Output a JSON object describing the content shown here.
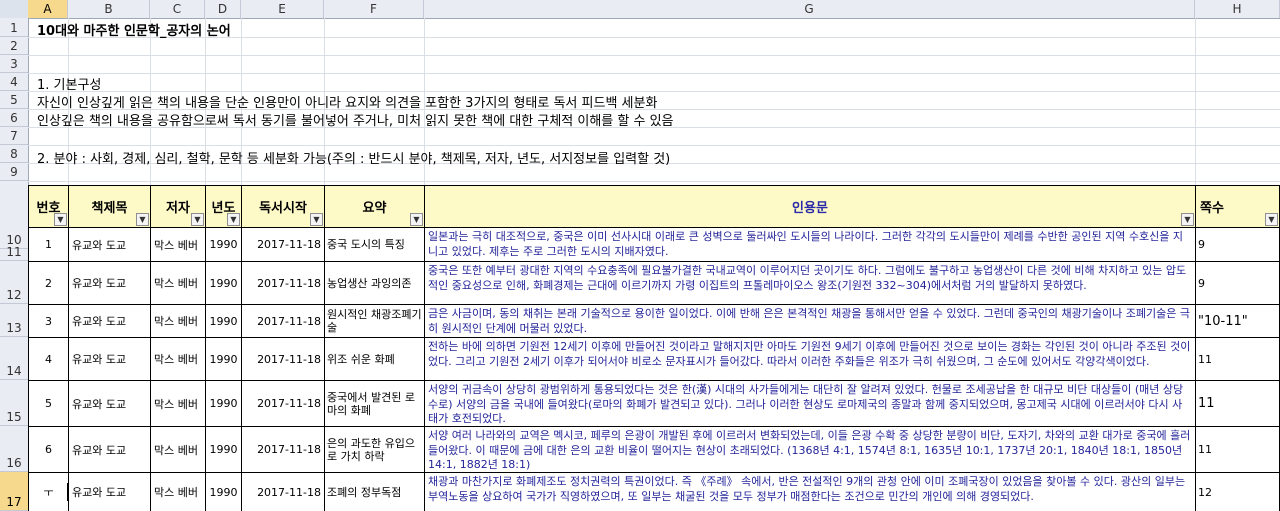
{
  "columns": [
    "A",
    "B",
    "C",
    "D",
    "E",
    "F",
    "G",
    "H"
  ],
  "rows": [
    "1",
    "2",
    "3",
    "4",
    "5",
    "6",
    "7",
    "8",
    "9",
    "10",
    "11",
    "12",
    "13",
    "14",
    "15",
    "16",
    "17"
  ],
  "title": "10대와 마주한 인문학_공자의 논어",
  "intro": {
    "line4": "1. 기본구성",
    "line5": "자신이 인상깊게 읽은 책의 내용을 단순 인용만이 아니라 요지와 의견을 포함한 3가지의 형태로 독서 피드백 세분화",
    "line6": "인상깊은 책의 내용을 공유함으로써 독서 동기를 불어넣어 주거나, 미처 읽지 못한 책에 대한 구체적 이해를 할 수 있음",
    "line8": "2. 분야 : 사회, 경제, 심리, 철학, 문학 등 세분화 가능(주의 : 반드시 분야, 책제목, 저자, 년도, 서지정보를 입력할 것)"
  },
  "table": {
    "headers": [
      "번호",
      "책제목",
      "저자",
      "년도",
      "독서시작",
      "요약",
      "인용문",
      "쪽수"
    ],
    "filter_icon": "dropdown-arrow",
    "rows": [
      {
        "no": "1",
        "book": "유교와 도교",
        "author": "막스 베버",
        "year": "1990",
        "date": "2017-11-18",
        "summary": "중국 도시의 특징",
        "quote": "일본과는 극히 대조적으로, 중국은 이미 선사시대 이래로 큰 성벽으로 둘러싸인 도시들의 나라이다. 그러한 각각의 도시들만이 제례를 수반한 공인된 지역 수호신을 지니고 있었다. 제후는 주로 그러한 도시의 지배자였다.",
        "page": "9"
      },
      {
        "no": "2",
        "book": "유교와 도교",
        "author": "막스 베버",
        "year": "1990",
        "date": "2017-11-18",
        "summary": "농업생산 과잉의존",
        "quote": "중국은 또한 예부터 광대한 지역의 수요충족에 필요불가결한 국내교역이 이루어지던 곳이기도 하다. 그럼에도 불구하고 농업생산이 다른 것에 비해 차지하고 있는 압도적인 중요성으로 인해, 화폐경제는 근대에 이르기까지 가령 이집트의 프톨레마이오스 왕조(기원전 332~304)에서처럼 거의 발달하지 못하였다.",
        "page": "9"
      },
      {
        "no": "3",
        "book": "유교와 도교",
        "author": "막스 베버",
        "year": "1990",
        "date": "2017-11-18",
        "summary": "원시적인 채광조폐기술",
        "quote": "금은 사금이며, 동의 채취는 본래 기술적으로 용이한 일이었다. 이에 반해 은은 본격적인 채광을 통해서만 얻을 수 있었다. 그런데 중국인의 채광기술이나 조폐기술은 극히 원시적인 단계에 머물러 있었다.",
        "page": "\"10-11\""
      },
      {
        "no": "4",
        "book": "유교와 도교",
        "author": "막스 베버",
        "year": "1990",
        "date": "2017-11-18",
        "summary": "위조 쉬운 화폐",
        "quote": "전하는 바에 의하면 기원전 12세기 이후에 만들어진 것이라고 말해지지만 아마도 기원전 9세기 이후에 만들어진 것으로 보이는 경화는 각인된 것이 아니라 주조된 것이었다. 그리고 기원전 2세기 이후가 되어서야 비로소 문자표시가 들어갔다. 따라서 이러한 주화들은 위조가 극히 쉬웠으며, 그 순도에 있어서도 각양각색이었다.",
        "page": "11"
      },
      {
        "no": "5",
        "book": "유교와 도교",
        "author": "막스 베버",
        "year": "1990",
        "date": "2017-11-18",
        "summary": "중국에서 발견된 로마의 화폐",
        "quote": "서양의 귀금속이 상당히 광범위하게 통용되었다는 것은 한(漢) 시대의 사가들에게는 대단히 잘 알려져 있었다. 헌물로 조세공납을 한 대규모 비단 대상들이 (매년 상당수로) 서양의 금을 국내에 들여왔다(로마의 화폐가 발견되고 있다). 그러나 이러한 현상도 로마제국의 종말과 함께 중지되었으며, 몽고제국 시대에 이르러서야 다시 사태가 호전되었다.",
        "page": "11"
      },
      {
        "no": "6",
        "book": "유교와 도교",
        "author": "막스 베버",
        "year": "1990",
        "date": "2017-11-18",
        "summary": "은의 과도한 유입으로 가치 하락",
        "quote": "서양 여러 나라와의 교역은 멕시코, 페루의 은광이 개발된 후에 이르러서 변화되었는데, 이들 은광 수확 중 상당한 분량이 비단, 도자기, 차와의 교환 대가로 중국에 흘러들어왔다. 이 때문에 금에 대한 은의 교환 비율이 떨어지는 현상이 초래되었다. (1368년 4:1, 1574년 8:1, 1635년 10:1, 1737년 20:1, 1840년 18:1, 1850년 14:1, 1882년 18:1)",
        "page": "11"
      },
      {
        "no": "ㅜ",
        "book": "유교와 도교",
        "author": "막스 베버",
        "year": "1990",
        "date": "2017-11-18",
        "summary": "조폐의 정부독점",
        "quote": "채광과 마찬가지로 화폐제조도 정치권력의 특권이었다. 즉 《주례》 속에서, 반은 전설적인 9개의 관청 안에 이미 조폐국장이 있었음을 찾아볼 수 있다. 광산의 일부는 부역노동을 상요하여 국가가 직영하였으며, 또 일부는 채굴된 것을 모두 정부가 매점한다는 조건으로 민간의 개인에 의해 경영되었다.",
        "page": "12"
      }
    ]
  }
}
